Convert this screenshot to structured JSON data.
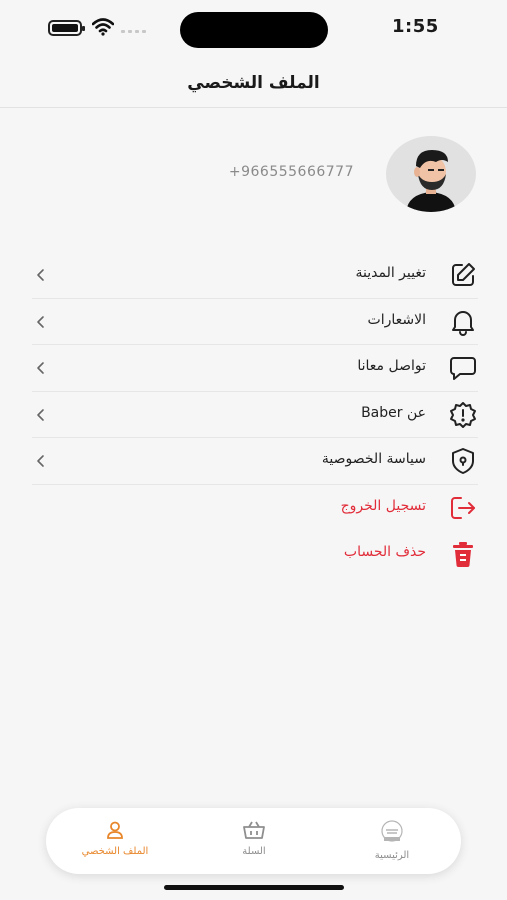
{
  "status_bar": {
    "time": "1:55"
  },
  "header": {
    "title": "الملف الشخصي"
  },
  "profile": {
    "phone": "+966555666777"
  },
  "menu": {
    "items": [
      {
        "label": "تغيير المدينة",
        "icon": "edit-icon"
      },
      {
        "label": "الاشعارات",
        "icon": "bell-icon"
      },
      {
        "label": "تواصل معانا",
        "icon": "chat-icon"
      },
      {
        "label": "عن Baber",
        "icon": "info-badge-icon"
      },
      {
        "label": "سياسة الخصوصية",
        "icon": "shield-icon"
      },
      {
        "label": "تسجيل الخروج",
        "icon": "logout-icon"
      },
      {
        "label": "حذف الحساب",
        "icon": "trash-icon"
      }
    ]
  },
  "tabbar": {
    "tabs": [
      {
        "label": "الملف الشخصي",
        "icon": "user-icon",
        "active": true
      },
      {
        "label": "السلة",
        "icon": "basket-icon",
        "active": false
      },
      {
        "label": "الرئيسية",
        "icon": "home-logo-icon",
        "active": false
      }
    ]
  },
  "colors": {
    "accent": "#e8862a",
    "danger": "#e12d3a",
    "background": "#f6f6f6"
  }
}
